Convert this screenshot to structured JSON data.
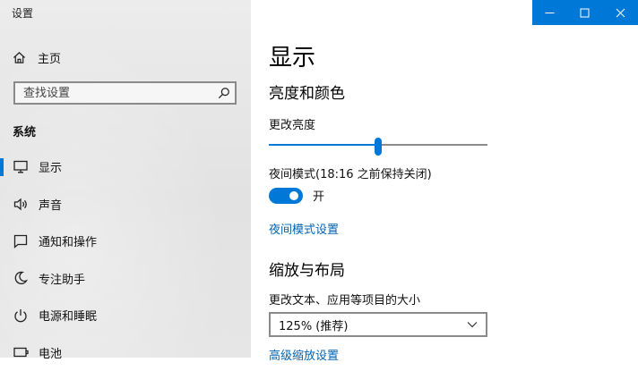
{
  "window": {
    "title": "设置"
  },
  "sidebar": {
    "home": {
      "label": "主页",
      "icon": "home-icon"
    },
    "search": {
      "placeholder": "查找设置",
      "icon": "search-icon"
    },
    "section": "系统",
    "items": [
      {
        "label": "显示",
        "icon": "monitor-icon",
        "active": true
      },
      {
        "label": "声音",
        "icon": "speaker-icon"
      },
      {
        "label": "通知和操作",
        "icon": "notification-icon"
      },
      {
        "label": "专注助手",
        "icon": "moon-icon"
      },
      {
        "label": "电源和睡眠",
        "icon": "power-icon"
      },
      {
        "label": "电池",
        "icon": "battery-icon"
      }
    ]
  },
  "main": {
    "title": "显示",
    "brightness": {
      "heading": "亮度和颜色",
      "slider_label": "更改亮度",
      "slider_value": 0.5,
      "night_light_label": "夜间模式(18:16 之前保持关闭)",
      "toggle_on": true,
      "toggle_text": "开",
      "settings_link": "夜间模式设置"
    },
    "scale": {
      "heading": "缩放与布局",
      "label": "更改文本、应用等项目的大小",
      "dropdown_value": "125% (推荐)",
      "advanced_link": "高级缩放设置"
    }
  },
  "colors": {
    "accent": "#0078d7",
    "link": "#0063b1"
  }
}
